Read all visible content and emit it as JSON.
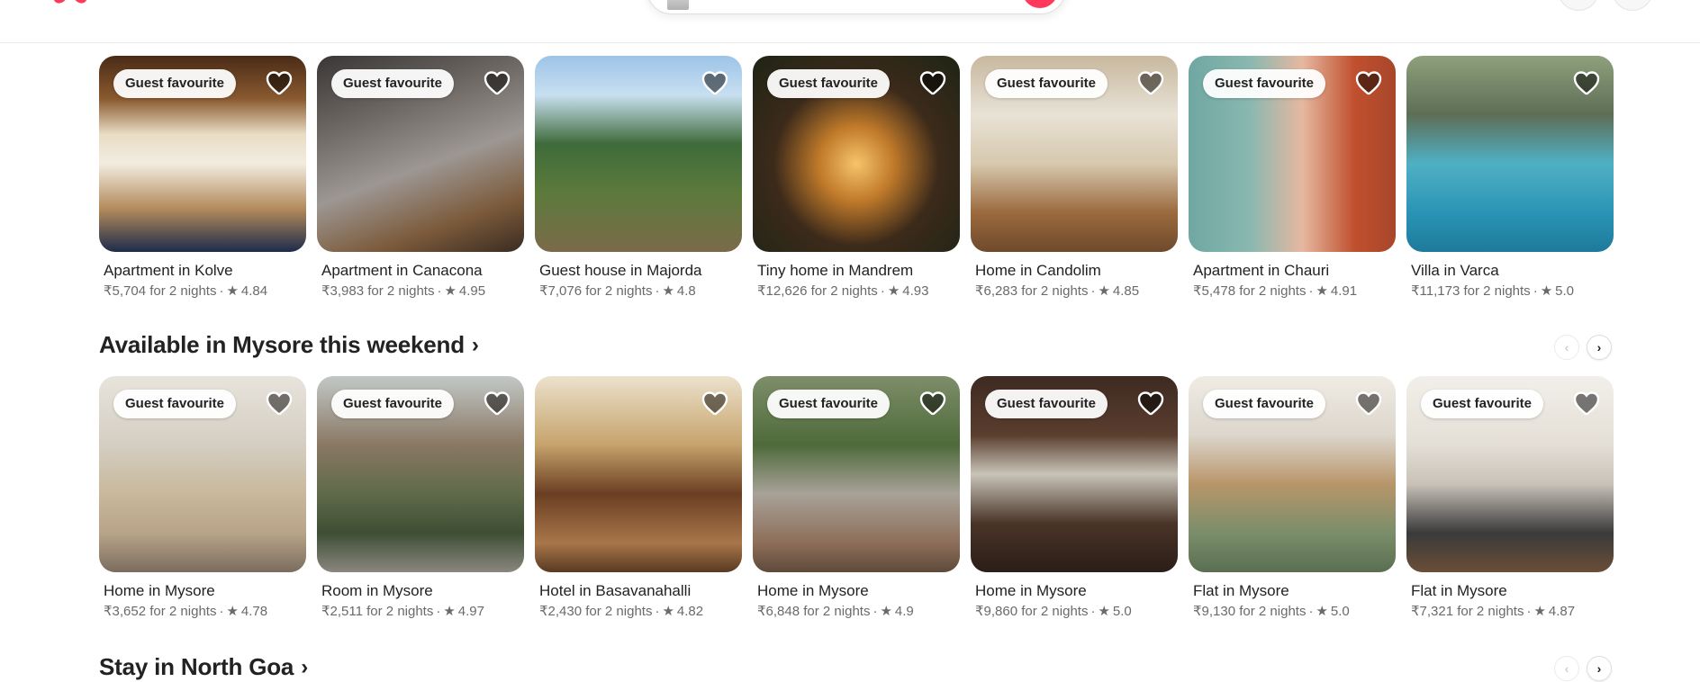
{
  "header": {
    "logo_icon": "airbnb-logo-icon",
    "brand_color": "#ff385c"
  },
  "row1": [
    {
      "badge": "Guest favourite",
      "title": "Apartment in Kolve",
      "price": "₹5,704 for 2 nights",
      "rating": "4.84"
    },
    {
      "badge": "Guest favourite",
      "title": "Apartment in Canacona",
      "price": "₹3,983 for 2 nights",
      "rating": "4.95"
    },
    {
      "badge": "",
      "title": "Guest house in Majorda",
      "price": "₹7,076 for 2 nights",
      "rating": "4.8"
    },
    {
      "badge": "Guest favourite",
      "title": "Tiny home in Mandrem",
      "price": "₹12,626 for 2 nights",
      "rating": "4.93"
    },
    {
      "badge": "Guest favourite",
      "title": "Home in Candolim",
      "price": "₹6,283 for 2 nights",
      "rating": "4.85"
    },
    {
      "badge": "Guest favourite",
      "title": "Apartment in Chauri",
      "price": "₹5,478 for 2 nights",
      "rating": "4.91"
    },
    {
      "badge": "",
      "title": "Villa in Varca",
      "price": "₹11,173 for 2 nights",
      "rating": "5.0"
    }
  ],
  "section2": {
    "title": "Available in Mysore this weekend",
    "chevron": "›"
  },
  "row2": [
    {
      "badge": "Guest favourite",
      "title": "Home in Mysore",
      "price": "₹3,652 for 2 nights",
      "rating": "4.78"
    },
    {
      "badge": "Guest favourite",
      "title": "Room in Mysore",
      "price": "₹2,511 for 2 nights",
      "rating": "4.97"
    },
    {
      "badge": "",
      "title": "Hotel in Basavanahalli",
      "price": "₹2,430 for 2 nights",
      "rating": "4.82"
    },
    {
      "badge": "Guest favourite",
      "title": "Home in Mysore",
      "price": "₹6,848 for 2 nights",
      "rating": "4.9"
    },
    {
      "badge": "Guest favourite",
      "title": "Home in Mysore",
      "price": "₹9,860 for 2 nights",
      "rating": "5.0"
    },
    {
      "badge": "Guest favourite",
      "title": "Flat in Mysore",
      "price": "₹9,130 for 2 nights",
      "rating": "5.0"
    },
    {
      "badge": "Guest favourite",
      "title": "Flat in Mysore",
      "price": "₹7,321 for 2 nights",
      "rating": "4.87"
    }
  ],
  "section3": {
    "title": "Stay in North Goa",
    "chevron": "›"
  },
  "nav": {
    "prev": "‹",
    "next": "›"
  },
  "symbols": {
    "star": "★",
    "dot": "·"
  }
}
